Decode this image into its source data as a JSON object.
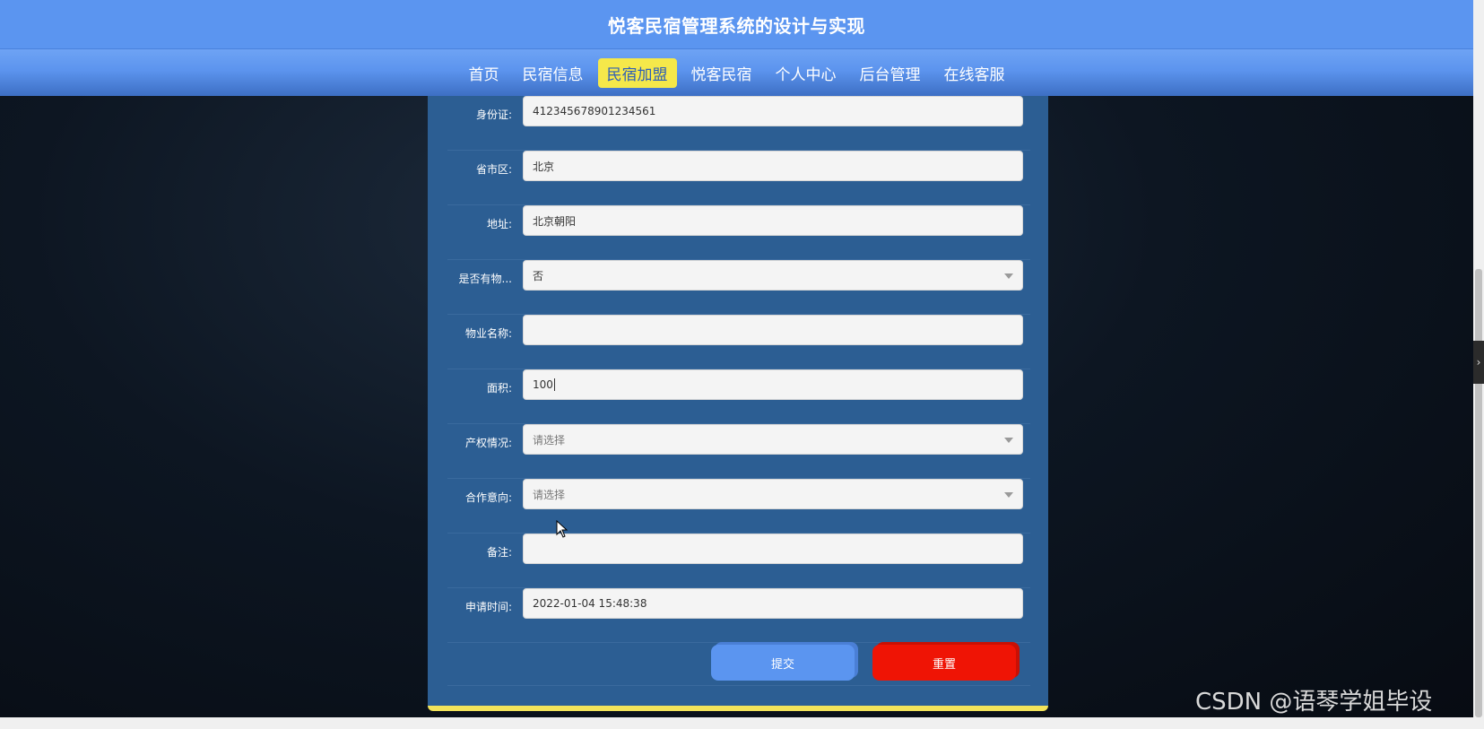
{
  "header": {
    "title": "悦客民宿管理系统的设计与实现"
  },
  "nav": {
    "items": [
      {
        "label": "首页"
      },
      {
        "label": "民宿信息"
      },
      {
        "label": "民宿加盟"
      },
      {
        "label": "悦客民宿"
      },
      {
        "label": "个人中心"
      },
      {
        "label": "后台管理"
      },
      {
        "label": "在线客服"
      }
    ],
    "active": "民宿加盟"
  },
  "form": {
    "fields": [
      {
        "label": "身份证:",
        "value": "412345678901234561",
        "type": "text"
      },
      {
        "label": "省市区:",
        "value": "北京",
        "type": "text"
      },
      {
        "label": "地址:",
        "value": "北京朝阳",
        "type": "text"
      },
      {
        "label": "是否有物...",
        "value": "否",
        "type": "select"
      },
      {
        "label": "物业名称:",
        "value": "",
        "type": "text"
      },
      {
        "label": "面积:",
        "value": "100",
        "type": "text"
      },
      {
        "label": "产权情况:",
        "value": "",
        "placeholder": "请选择",
        "type": "select"
      },
      {
        "label": "合作意向:",
        "value": "",
        "placeholder": "请选择",
        "type": "select"
      },
      {
        "label": "备注:",
        "value": "",
        "type": "text"
      },
      {
        "label": "申请时间:",
        "value": "2022-01-04 15:48:38",
        "type": "text"
      }
    ],
    "submit_label": "提交",
    "reset_label": "重置"
  },
  "watermark": "CSDN @语琴学姐毕设",
  "colors": {
    "header_bg": "#5b95f0",
    "nav_active_bg": "#f5e84a",
    "panel_bg": "#2c5e93",
    "submit_bg": "#5b95f0",
    "reset_bg": "#ef1405"
  }
}
